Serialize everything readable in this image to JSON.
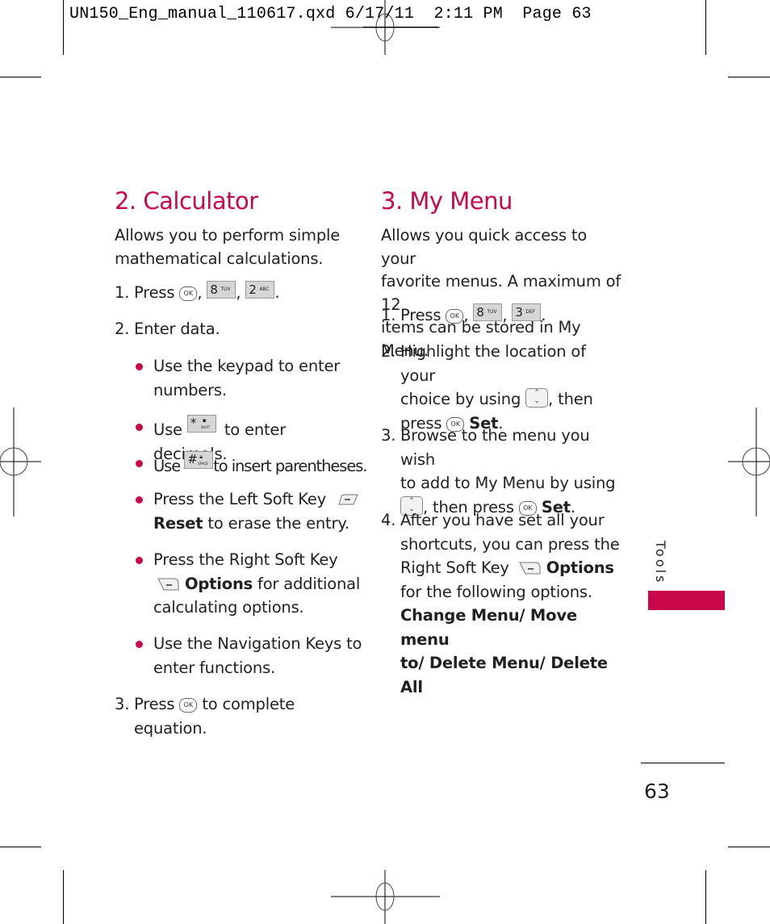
{
  "slug": {
    "filename": "UN150_Eng_manual_110617.qxd",
    "date": "6/17/11",
    "time": "2:11 PM",
    "page_label": "Page 63"
  },
  "colors": {
    "accent": "#c8084a",
    "text": "#231f20"
  },
  "calculator": {
    "heading": "2. Calculator",
    "intro": [
      "Allows you to perform simple",
      "mathematical calculations."
    ],
    "step1": {
      "num": "1.",
      "text": "Press",
      "keys": [
        "ok-key-icon",
        "8-tuv-key-icon",
        "2-abc-key-icon"
      ]
    },
    "step2": {
      "num": "2.",
      "text": "Enter data."
    },
    "bullets": [
      {
        "lines": [
          "Use the keypad to enter",
          "numbers."
        ]
      },
      {
        "pre": "Use",
        "key": "star-shift-key-icon",
        "post": "to enter decimals."
      },
      {
        "pre": "Use",
        "key": "pound-space-key-icon",
        "post": "to insert parentheses."
      },
      {
        "line1": "Press the Left Soft Key",
        "bold": "Reset",
        "rest": "to erase the entry."
      },
      {
        "line1": "Press the Right Soft Key",
        "bold": "Options",
        "rest": "for additional",
        "line3": "calculating options."
      },
      {
        "lines": [
          "Use the Navigation Keys to",
          "enter functions."
        ]
      }
    ],
    "step3": {
      "num": "3.",
      "pre": "Press",
      "post": "to complete",
      "line2": "equation."
    }
  },
  "mymenu": {
    "heading": "3. My Menu",
    "intro": [
      "Allows you quick access to your",
      "favorite menus. A maximum of 12",
      "items can be stored in My Menu."
    ],
    "step1": {
      "num": "1.",
      "text": "Press",
      "keys": [
        "ok-key-icon",
        "8-tuv-key-icon",
        "3-def-key-icon"
      ]
    },
    "step2": {
      "num": "2.",
      "line1": "Highlight the location of your",
      "line2_pre": "choice by using",
      "line2_post": ", then",
      "line3_pre": "press",
      "bold": "Set"
    },
    "step3": {
      "num": "3.",
      "line1": "Browse to the menu you wish",
      "line2": "to add to My Menu by using",
      "line3_mid": ", then press",
      "bold": "Set"
    },
    "step4": {
      "num": "4.",
      "line1": "After you have set all your",
      "line2": "shortcuts, you can press the",
      "line3_pre": "Right Soft Key",
      "bold": "Options",
      "line4": "for the following options.",
      "options_line1": "Change Menu/ Move menu",
      "options_line2": "to/ Delete Menu/ Delete All"
    }
  },
  "keys": {
    "ok": "OK",
    "eight": "8",
    "tuv": "TUV",
    "two": "2",
    "abc": "ABC",
    "three": "3",
    "def": "DEF",
    "star": "*",
    "shift": "SHIFT",
    "pound": "#",
    "space": "SPACE",
    "up": "⌃",
    "down": "⌄"
  },
  "side_tab": {
    "label": "Tools"
  },
  "page_number": "63"
}
